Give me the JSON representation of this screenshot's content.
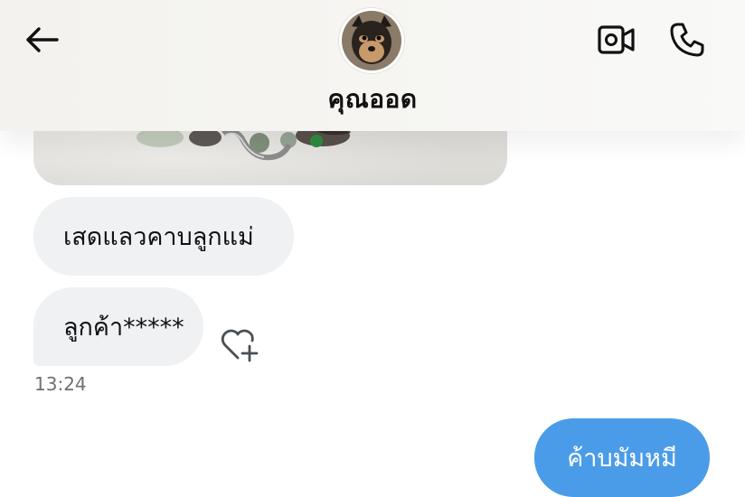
{
  "header": {
    "contact_name": "คุณออด"
  },
  "messages": [
    {
      "direction": "incoming",
      "text": "เสดแลวคาบลูกแม่"
    },
    {
      "direction": "incoming",
      "text": "ลูกค้า*****"
    },
    {
      "direction": "outgoing",
      "text": "ค้าบมัมหมี"
    }
  ],
  "timestamp": "13:24",
  "colors": {
    "incoming_bubble": "#eff1f3",
    "outgoing_bubble": "#4b9ce8",
    "header_bg": "#f3f2ee"
  },
  "icons": [
    "back-arrow-icon",
    "video-camera-icon",
    "phone-icon",
    "heart-plus-icon"
  ]
}
